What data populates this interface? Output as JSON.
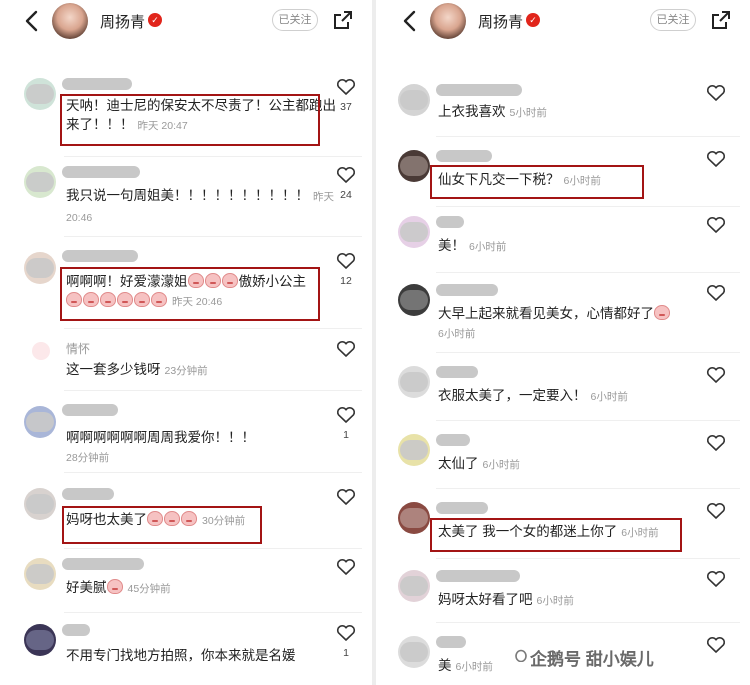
{
  "header": {
    "name": "周扬青",
    "follow_label": "已关注",
    "colors": {
      "verified": "#e1251b",
      "highlight": "#a31414"
    }
  },
  "left": {
    "comments": [
      {
        "text": "天呐！迪士尼的保安太不尽责了！公主都跑出来了！！！",
        "time": "昨天 20:47",
        "likes": "37"
      },
      {
        "text": "我只说一句周姐美！！！！！！！！！！",
        "time": "昨天 20:46",
        "likes": "24"
      },
      {
        "text": "啊啊啊！好爱濛濛姐",
        "text2": "傲娇小公主",
        "time": "昨天 20:46",
        "likes": "12"
      },
      {
        "username": "情怀",
        "text": "这一套多少钱呀",
        "time": "23分钟前",
        "likes": ""
      },
      {
        "text": "啊啊啊啊啊啊周周我爱你！！！",
        "time": "28分钟前",
        "likes": "1"
      },
      {
        "text": "妈呀也太美了",
        "time": "30分钟前",
        "likes": ""
      },
      {
        "text": "好美腻",
        "time": "45分钟前",
        "likes": ""
      },
      {
        "text": "不用专门找地方拍照，你本来就是名媛",
        "time": "",
        "likes": "1"
      }
    ]
  },
  "right": {
    "comments": [
      {
        "text": "上衣我喜欢",
        "time": "5小时前"
      },
      {
        "text": "仙女下凡交一下税？",
        "time": "6小时前"
      },
      {
        "text": "美！",
        "time": "6小时前"
      },
      {
        "text": "大早上起来就看见美女，心情都好了",
        "time": "6小时前"
      },
      {
        "text": "衣服太美了，一定要入！",
        "time": "6小时前"
      },
      {
        "text": "太仙了",
        "time": "6小时前"
      },
      {
        "text": "太美了 我一个女的都迷上你了",
        "time": "6小时前"
      },
      {
        "text": "妈呀太好看了吧",
        "time": "6小时前"
      },
      {
        "text": "美",
        "time": "6小时前"
      }
    ]
  },
  "watermark": "企鹅号 甜小娱儿"
}
